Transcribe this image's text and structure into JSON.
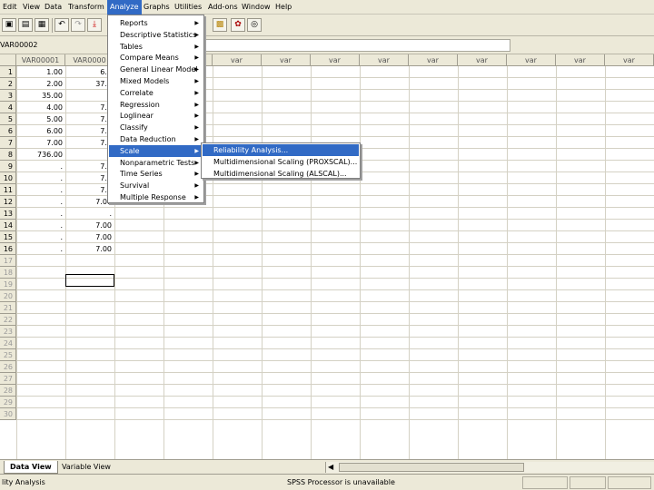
{
  "menubar": {
    "items": [
      "Edit",
      "View",
      "Data",
      "Transform",
      "Analyze",
      "Graphs",
      "Utilities",
      "Add-ons",
      "Window",
      "Help"
    ]
  },
  "cell_editor": {
    "reference": "VAR00002",
    "value": ""
  },
  "grid": {
    "columns": [
      "VAR00001",
      "VAR0000",
      "",
      "",
      "var",
      "var",
      "var",
      "var",
      "var",
      "var",
      "var",
      "var"
    ],
    "row_numbers": [
      "1",
      "2",
      "3",
      "4",
      "5",
      "6",
      "7",
      "8",
      "9",
      "10",
      "11",
      "12",
      "13",
      "14",
      "15",
      "16",
      "17",
      "18",
      "19",
      "20",
      "21",
      "22",
      "23",
      "24",
      "25",
      "26",
      "27",
      "28",
      "29",
      "30"
    ],
    "var00001": [
      "1.00",
      "2.00",
      "35.00",
      "4.00",
      "5.00",
      "6.00",
      "7.00",
      "736.00",
      ".",
      ".",
      ".",
      ".",
      ".",
      ".",
      ".",
      "."
    ],
    "var00002": [
      "6.0",
      "37.0",
      "",
      "7.0",
      "7.0",
      "7.0",
      "7.0",
      "",
      "7.0",
      "7.0",
      "7.0",
      "7.00",
      ".",
      "7.00",
      "7.00",
      "7.00"
    ]
  },
  "analyze_menu": {
    "items": [
      "Reports",
      "Descriptive Statistics",
      "Tables",
      "Compare Means",
      "General Linear Model",
      "Mixed Models",
      "Correlate",
      "Regression",
      "Loglinear",
      "Classify",
      "Data Reduction",
      "Scale",
      "Nonparametric Tests",
      "Time Series",
      "Survival",
      "Multiple Response"
    ],
    "highlighted": "Scale"
  },
  "scale_submenu": {
    "items": [
      "Reliability Analysis...",
      "Multidimensional Scaling (PROXSCAL)...",
      "Multidimensional Scaling (ALSCAL)..."
    ],
    "highlighted": "Reliability Analysis..."
  },
  "sheet_tabs": {
    "data_view": "Data View",
    "variable_view": "Variable View"
  },
  "statusbar": {
    "left": "lity Analysis",
    "center": "SPSS Processor is unavailable"
  },
  "colors": {
    "highlight": "#316ac5",
    "chrome": "#ece9d8"
  }
}
